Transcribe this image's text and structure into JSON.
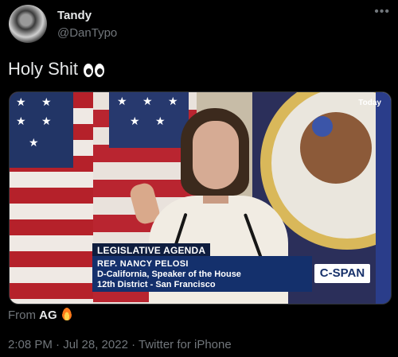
{
  "author": {
    "name": "Tandy",
    "handle": "@DanTypo"
  },
  "tweet": {
    "text": "Holy Shit",
    "emoji": "eyes"
  },
  "media": {
    "watermark": "Today",
    "chyron_title": "LEGISLATIVE AGENDA",
    "chyron_name": "REP. NANCY PELOSI",
    "chyron_line2": "D-California, Speaker of the House",
    "chyron_line3": "12th District - San Francisco",
    "network_logo": "C-SPAN"
  },
  "source": {
    "prefix": "From",
    "name": "AG",
    "emoji": "fire"
  },
  "meta": {
    "timestamp": "2:08 PM · Jul 28, 2022 · Twitter for iPhone"
  },
  "icons": {
    "more": "more-horizontal-icon"
  }
}
